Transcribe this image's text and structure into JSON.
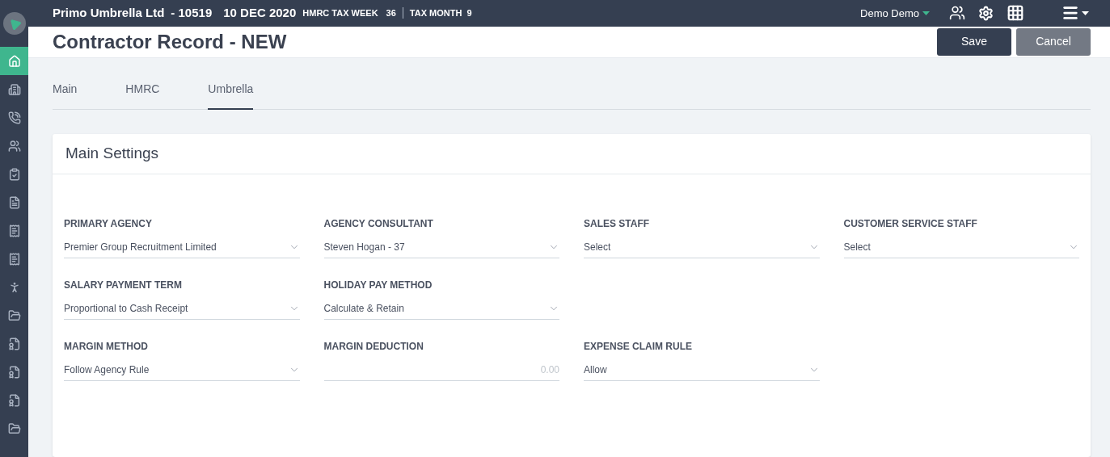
{
  "topbar": {
    "company": "Primo Umbrella Ltd",
    "company_number": "- 10519",
    "date": "10 DEC 2020",
    "tax_week_label": "HMRC TAX WEEK",
    "tax_week": "36",
    "tax_month_label": "TAX MONTH",
    "tax_month": "9",
    "user": "Demo Demo"
  },
  "sidebar": {
    "items": [
      {
        "selected": true
      },
      {
        "selected": false
      },
      {
        "selected": false
      },
      {
        "selected": false
      },
      {
        "selected": false
      },
      {
        "selected": false
      },
      {
        "selected": false
      },
      {
        "selected": false
      },
      {
        "selected": false
      },
      {
        "selected": false
      },
      {
        "selected": false
      },
      {
        "selected": false
      },
      {
        "selected": false
      },
      {
        "selected": false
      }
    ]
  },
  "page": {
    "title": "Contractor Record - NEW",
    "buttons": [
      {
        "label": "Save",
        "kind": "primary"
      },
      {
        "label": "Cancel",
        "kind": "secondary"
      }
    ]
  },
  "tabs": [
    {
      "label": "Main",
      "selected": false
    },
    {
      "label": "HMRC",
      "selected": false
    },
    {
      "label": "Umbrella",
      "selected": true
    }
  ],
  "card": {
    "title": "Main Settings",
    "rows": [
      [
        {
          "label": "PRIMARY AGENCY",
          "kind": "select",
          "value": "Premier Group Recruitment Limited"
        },
        {
          "label": "AGENCY CONSULTANT",
          "kind": "select",
          "value": "Steven Hogan - 37"
        },
        {
          "label": "SALES STAFF",
          "kind": "select",
          "value": "Select"
        },
        {
          "label": "CUSTOMER SERVICE STAFF",
          "kind": "select",
          "value": "Select"
        }
      ],
      [
        {
          "label": "SALARY PAYMENT TERM",
          "kind": "select",
          "value": "Proportional to Cash Receipt"
        },
        {
          "label": "HOLIDAY PAY METHOD",
          "kind": "select",
          "value": "Calculate & Retain"
        }
      ],
      [
        {
          "label": "MARGIN METHOD",
          "kind": "select",
          "value": "Follow Agency Rule"
        },
        {
          "label": "MARGIN DEDUCTION",
          "kind": "input",
          "placeholder": "0.00"
        },
        {
          "label": "EXPENSE CLAIM RULE",
          "kind": "select",
          "value": "Allow"
        }
      ]
    ]
  }
}
